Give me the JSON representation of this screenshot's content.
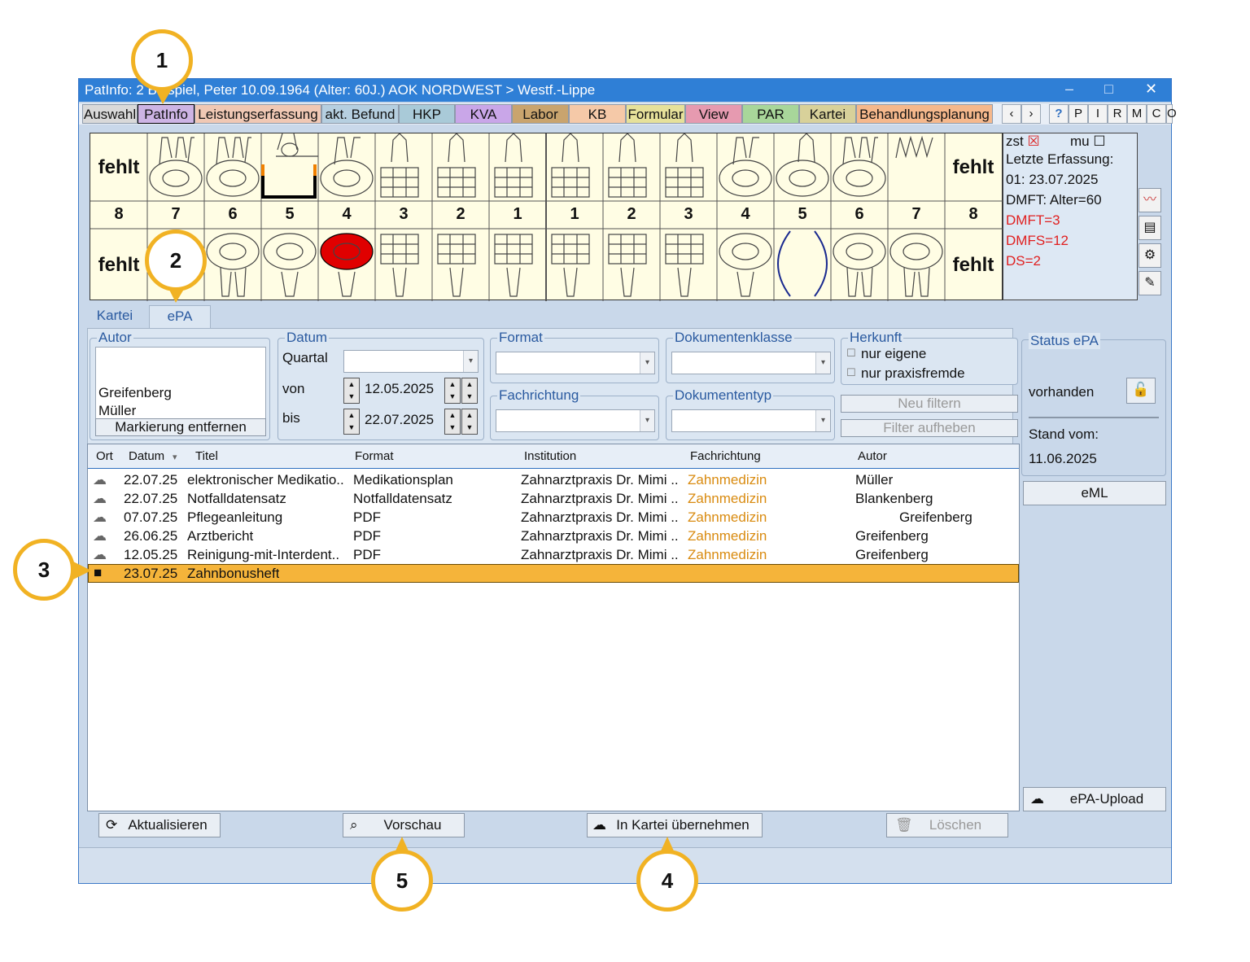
{
  "window": {
    "title": "PatInfo: 2 Beispiel, Peter  10.09.1964 (Alter: 60J.)  AOK NORDWEST > Westf.-Lippe",
    "controls": [
      "–",
      "□",
      "✕"
    ]
  },
  "tabs": [
    "Auswahl",
    "PatInfo",
    "Leistungserfassung",
    "akt. Befund",
    "HKP",
    "KVA",
    "Labor",
    "KB",
    "Formular",
    "View",
    "PAR",
    "Kartei",
    "Behandlungsplanung"
  ],
  "tab_colors": [
    "#d9d9d9",
    "#cdb4e4",
    "#f0c8b4",
    "#b6cfe0",
    "#a9cad8",
    "#c9a6e8",
    "#c9a46e",
    "#f5c9a8",
    "#e6e19a",
    "#e69ab0",
    "#a8d69a",
    "#d8d19a",
    "#f5b88c"
  ],
  "nav_buttons": [
    "‹",
    "›",
    "?",
    "P",
    "I",
    "R",
    "M",
    "C",
    "O"
  ],
  "chart": {
    "upper_left_fehlt": "fehlt",
    "upper_right_fehlt": "fehlt",
    "lower_left_fehlt": "fehlt",
    "lower_right_fehlt": "fehlt",
    "numbers": [
      "8",
      "7",
      "6",
      "5",
      "4",
      "3",
      "2",
      "1",
      "1",
      "2",
      "3",
      "4",
      "5",
      "6",
      "7",
      "8"
    ]
  },
  "info": {
    "zst": "zst",
    "mu": "mu",
    "lines": [
      "Letzte Erfassung:",
      "01: 23.07.2025",
      "DMFT: Alter=60"
    ],
    "red_lines": [
      "DMFT=3",
      "DMFS=12",
      "DS=2"
    ]
  },
  "subtabs": [
    "Kartei",
    "ePA"
  ],
  "filters": {
    "autor_legend": "Autor",
    "autor_items": [
      "Greifenberg",
      "Müller"
    ],
    "markierung": "Markierung entfernen",
    "datum_legend": "Datum",
    "quartal_label": "Quartal",
    "von_label": "von",
    "von_value": "12.05.2025",
    "bis_label": "bis",
    "bis_value": "22.07.2025",
    "format_legend": "Format",
    "dokumentenklasse_legend": "Dokumentenklasse",
    "fachrichtung_legend": "Fachrichtung",
    "dokumententyp_legend": "Dokumententyp",
    "herkunft_legend": "Herkunft",
    "nur_eigene": "nur eigene",
    "nur_praxisfremde": "nur praxisfremde",
    "neu_filtern": "Neu filtern",
    "filter_aufheben": "Filter aufheben"
  },
  "status": {
    "legend": "Status ePA",
    "value": "vorhanden",
    "stand_label": "Stand vom:",
    "stand_value": "11.06.2025",
    "eml": "eML",
    "upload": "ePA-Upload"
  },
  "table": {
    "headers": [
      "Ort",
      "Datum",
      "Titel",
      "Format",
      "Institution",
      "Fachrichtung",
      "Autor"
    ],
    "rows": [
      {
        "datum": "22.07.25",
        "titel": "elektronischer Medikatio..",
        "format": "Medikationsplan",
        "institution": "Zahnarztpraxis Dr. Mimi ..",
        "fach": "Zahnmedizin",
        "autor": "Müller"
      },
      {
        "datum": "22.07.25",
        "titel": "Notfalldatensatz",
        "format": "Notfalldatensatz",
        "institution": "Zahnarztpraxis Dr. Mimi ..",
        "fach": "Zahnmedizin",
        "autor": "Blankenberg"
      },
      {
        "datum": "07.07.25",
        "titel": "Pflegeanleitung",
        "format": "PDF",
        "institution": "Zahnarztpraxis Dr. Mimi ..",
        "fach": "Zahnmedizin",
        "autor": "Greifenberg"
      },
      {
        "datum": "26.06.25",
        "titel": "Arztbericht",
        "format": "PDF",
        "institution": "Zahnarztpraxis Dr. Mimi ..",
        "fach": "Zahnmedizin",
        "autor": "Greifenberg"
      },
      {
        "datum": "12.05.25",
        "titel": "Reinigung-mit-Interdent..",
        "format": "PDF",
        "institution": "Zahnarztpraxis Dr. Mimi ..",
        "fach": "Zahnmedizin",
        "autor": "Greifenberg"
      },
      {
        "datum": "23.07.25",
        "titel": "Zahnbonusheft",
        "format": "",
        "institution": "",
        "fach": "",
        "autor": ""
      }
    ]
  },
  "buttons": {
    "aktualisieren": "Aktualisieren",
    "vorschau": "Vorschau",
    "in_kartei": "In Kartei übernehmen",
    "loeschen": "Löschen"
  },
  "callouts": [
    "1",
    "2",
    "3",
    "4",
    "5"
  ]
}
